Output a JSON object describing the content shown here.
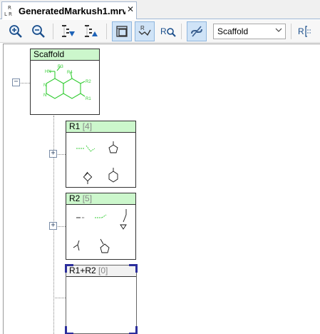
{
  "tab": {
    "title": "GeneratedMarkush1.mrv",
    "close": "✕",
    "icon_text": "R\nRR"
  },
  "toolbar": {
    "buttons": [
      "zoom-in",
      "zoom-out",
      "expand-all",
      "collapse-all",
      "layout",
      "r-group-layout",
      "find-r-group",
      "link-toggle",
      "r-group-settings"
    ],
    "combo_value": "Scaffold"
  },
  "tree": {
    "scaffold": {
      "label": "Scaffold",
      "atoms": {
        "r3": "R3",
        "nh": "HN",
        "r4": "R4",
        "r2": "R2",
        "r1": "R1",
        "n1": "N",
        "n2": "N"
      }
    },
    "r1": {
      "label": "R1",
      "count": "[4]"
    },
    "r2": {
      "label": "R2",
      "count": "[5]"
    },
    "r1r2": {
      "label": "R1+R2",
      "count": "[0]"
    },
    "expander_plus": "+",
    "expander_minus": "−"
  },
  "colors": {
    "accent_green": "#33cc33",
    "header_green": "#ccf7cc",
    "selection_blue": "#2b2e9c"
  }
}
